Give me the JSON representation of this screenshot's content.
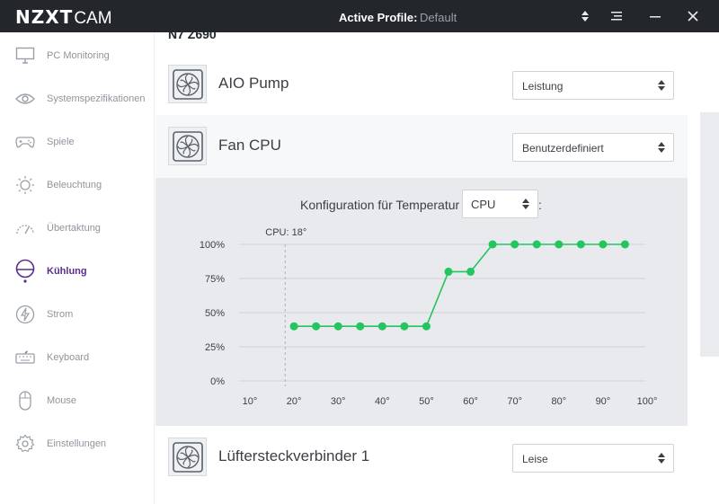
{
  "titlebar": {
    "brand": "NZXT",
    "app": "CAM",
    "profile_label": "Active Profile:",
    "profile_value": "Default",
    "icons": [
      "sort-icon",
      "menu-icon",
      "minimize-icon",
      "close-icon"
    ]
  },
  "sidebar": {
    "items": [
      {
        "label": "PC Monitoring",
        "icon": "monitor-icon"
      },
      {
        "label": "Systemspezifikationen",
        "icon": "eye-icon"
      },
      {
        "label": "Spiele",
        "icon": "gamepad-icon"
      },
      {
        "label": "Beleuchtung",
        "icon": "sun-icon"
      },
      {
        "label": "Übertaktung",
        "icon": "speedometer-icon"
      },
      {
        "label": "Kühlung",
        "icon": "cooling-icon",
        "active": true
      },
      {
        "label": "Strom",
        "icon": "lightning-icon"
      },
      {
        "label": "Keyboard",
        "icon": "keyboard-icon"
      },
      {
        "label": "Mouse",
        "icon": "mouse-icon"
      },
      {
        "label": "Einstellungen",
        "icon": "gear-icon"
      }
    ],
    "active_color": "#5b2c8f"
  },
  "main": {
    "device_name": "N7 Z690",
    "rows": [
      {
        "title": "AIO Pump",
        "mode": "Leistung"
      },
      {
        "title": "Fan CPU",
        "mode": "Benutzerdefiniert"
      },
      {
        "title": "Lüftersteckverbinder 1",
        "mode": "Leise"
      }
    ],
    "curve": {
      "config_label": "Konfiguration für Temperatur",
      "temp_source": "CPU",
      "colon": ":"
    }
  },
  "chart_data": {
    "type": "line",
    "title": "",
    "xlabel": "",
    "ylabel": "",
    "x": [
      20,
      25,
      30,
      35,
      40,
      45,
      50,
      55,
      60,
      65,
      70,
      75,
      80,
      85,
      90,
      95
    ],
    "series": [
      {
        "values": [
          40,
          40,
          40,
          40,
          40,
          40,
          40,
          80,
          80,
          100,
          100,
          100,
          100,
          100,
          100,
          100
        ]
      }
    ],
    "x_ticks": [
      "10°",
      "20°",
      "30°",
      "40°",
      "50°",
      "60°",
      "70°",
      "80°",
      "90°",
      "100°"
    ],
    "y_ticks": [
      "0%",
      "25%",
      "50%",
      "75%",
      "100%"
    ],
    "xlim": [
      10,
      100
    ],
    "ylim": [
      0,
      100
    ],
    "grid": true,
    "marker": {
      "label": "CPU: 18°",
      "x": 18
    },
    "color": "#22c55e"
  }
}
